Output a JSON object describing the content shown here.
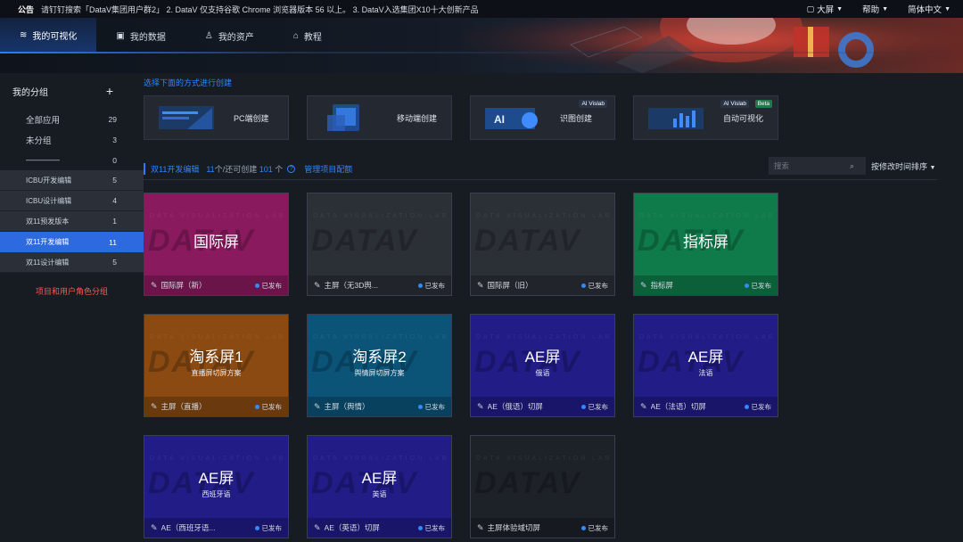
{
  "notice": {
    "label": "公告",
    "text": "请钉钉搜索「DataV集团用户群2」 2. DataV 仅支持谷歌 Chrome 浏览器版本 56 以上。 3. DataV入选集团X10十大创新产品"
  },
  "top_right": {
    "screen": "大屏",
    "help": "帮助",
    "language": "简体中文"
  },
  "nav": {
    "tabs": [
      {
        "label": "我的可视化",
        "icon": "layers-icon",
        "active": true
      },
      {
        "label": "我的数据",
        "icon": "data-icon",
        "active": false
      },
      {
        "label": "我的资产",
        "icon": "user-asset-icon",
        "active": false
      },
      {
        "label": "教程",
        "icon": "graduation-cap-icon",
        "active": false
      }
    ]
  },
  "sidebar": {
    "title": "我的分组",
    "add_icon": "plus-icon",
    "items": [
      {
        "label": "全部应用",
        "count": "29"
      },
      {
        "label": "未分组",
        "count": "3"
      },
      {
        "label": "————",
        "count": "0"
      },
      {
        "label": "ICBU开发编辑",
        "count": "5"
      },
      {
        "label": "ICBU设计编辑",
        "count": "4"
      },
      {
        "label": "双11预发版本",
        "count": "1"
      },
      {
        "label": "双11开发编辑",
        "count": "11"
      },
      {
        "label": "双11设计编辑",
        "count": "5"
      }
    ],
    "link": "项目和用户角色分组"
  },
  "create": {
    "title": "选择下面的方式进行创建",
    "cards": [
      {
        "label": "PC端创建",
        "badges": []
      },
      {
        "label": "移动端创建",
        "badges": []
      },
      {
        "label": "识图创建",
        "badges": [
          "AI Vislab"
        ]
      },
      {
        "label": "自动可视化",
        "badges": [
          "AI Vislab",
          "Beta"
        ]
      }
    ],
    "thumb_text": "AI"
  },
  "listbar": {
    "group": "双11开发编辑",
    "count": "11",
    "quota_mid": "个/还可创建",
    "remaining": "101",
    "quota_tail": "个",
    "help_icon": "question-circle-icon",
    "manage": "管理项目配额",
    "search_placeholder": "搜索",
    "sort": "按修改时间排序"
  },
  "watermark": {
    "line1": "DATA VISUALIZATION LAB",
    "line2": "DATAV"
  },
  "cards": [
    {
      "title": "国际屏",
      "subtitle": "",
      "name": "国际屏（新）",
      "status": "已发布",
      "color": "#8a1a5e"
    },
    {
      "title": "",
      "subtitle": "",
      "name": "主屏（无3D舆...",
      "status": "已发布",
      "color": "#2b2f36"
    },
    {
      "title": "",
      "subtitle": "",
      "name": "国际屏（旧）",
      "status": "已发布",
      "color": "#2b2f36"
    },
    {
      "title": "指标屏",
      "subtitle": "",
      "name": "指标屏",
      "status": "已发布",
      "color": "#0f7a4a"
    },
    {
      "title": "淘系屏1",
      "subtitle": "直播屏切屏方案",
      "name": "主屏（直播）",
      "status": "已发布",
      "color": "#8a4a12"
    },
    {
      "title": "淘系屏2",
      "subtitle": "舆情屏切屏方案",
      "name": "主屏（舆情）",
      "status": "已发布",
      "color": "#0b5478"
    },
    {
      "title": "AE屏",
      "subtitle": "俄语",
      "name": "AE（俄语）切屏",
      "status": "已发布",
      "color": "#211c86"
    },
    {
      "title": "AE屏",
      "subtitle": "法语",
      "name": "AE（法语）切屏",
      "status": "已发布",
      "color": "#211c86"
    },
    {
      "title": "AE屏",
      "subtitle": "西班牙语",
      "name": "AE（西班牙语...",
      "status": "已发布",
      "color": "#211c86"
    },
    {
      "title": "AE屏",
      "subtitle": "英语",
      "name": "AE（英语）切屏",
      "status": "已发布",
      "color": "#211c86"
    },
    {
      "title": "",
      "subtitle": "",
      "name": "主屏体验域切屏",
      "status": "已发布",
      "color": "#1d2128"
    }
  ],
  "colors": {
    "accent": "#2f7bff",
    "link_red": "#ff5a4d",
    "status_dot": "#2f8bff"
  }
}
